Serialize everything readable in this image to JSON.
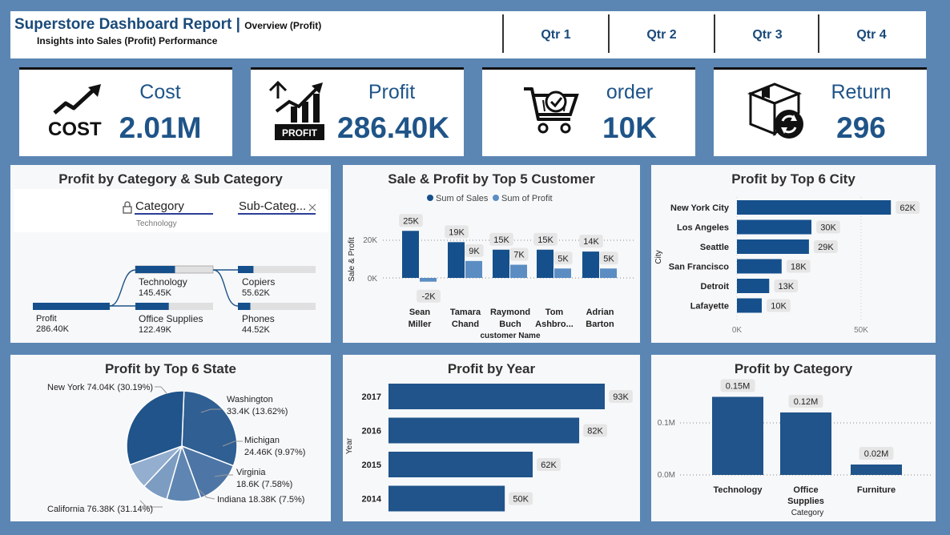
{
  "header": {
    "title": "Superstore Dashboard Report",
    "separator": "|",
    "page": "Overview (Profit)",
    "subtitle": "Insights into Sales (Profit) Performance",
    "quarters": [
      "Qtr 1",
      "Qtr 2",
      "Qtr 3",
      "Qtr 4"
    ]
  },
  "kpis": [
    {
      "label": "Cost",
      "value": "2.01M",
      "icon": "cost-trend-icon",
      "icon_text": "COST"
    },
    {
      "label": "Profit",
      "value": "286.40K",
      "icon": "profit-chart-icon",
      "icon_text": "PROFIT"
    },
    {
      "label": "order",
      "value": "10K",
      "icon": "shopping-cart-check-icon"
    },
    {
      "label": "Return",
      "value": "296",
      "icon": "return-box-icon"
    }
  ],
  "colors": {
    "primary": "#1f5488",
    "bar_dark": "#15508c",
    "bar_light": "#5b8dc3",
    "background": "#5b86b4"
  },
  "decomp_tree": {
    "title": "Profit by Category & Sub Category",
    "level1_label": "Category",
    "level1_value": "Technology",
    "level2_label": "Sub-Categ...",
    "root": {
      "label": "Profit",
      "value": "286.40K"
    },
    "categories": [
      {
        "label": "Technology",
        "value": "145.45K",
        "fraction": 0.51,
        "selected": true
      },
      {
        "label": "Office Supplies",
        "value": "122.49K",
        "fraction": 0.43
      }
    ],
    "subcategories": [
      {
        "label": "Copiers",
        "value": "55.62K",
        "fraction": 0.2
      },
      {
        "label": "Phones",
        "value": "44.52K",
        "fraction": 0.16
      }
    ]
  },
  "customers_chart": {
    "title": "Sale & Profit by Top 5 Customer",
    "ylabel": "Sale & Profit",
    "xlabel": "customer Name",
    "legend": [
      "Sum of Sales",
      "Sum of Profit"
    ],
    "yticks": [
      "20K",
      "0K"
    ],
    "categories": [
      [
        "Sean",
        "Miller"
      ],
      [
        "Tamara",
        "Chand"
      ],
      [
        "Raymond",
        "Buch"
      ],
      [
        "Tom",
        "Ashbro..."
      ],
      [
        "Adrian",
        "Barton"
      ]
    ],
    "sales_labels": [
      "25K",
      "19K",
      "15K",
      "15K",
      "14K"
    ],
    "profit_labels": [
      "-2K",
      "9K",
      "7K",
      "5K",
      "5K"
    ]
  },
  "city_chart": {
    "title": "Profit by Top 6 City",
    "ylabel": "City",
    "xticks": [
      "0K",
      "50K"
    ],
    "labels": [
      "62K",
      "30K",
      "29K",
      "18K",
      "13K",
      "10K"
    ]
  },
  "state_chart": {
    "title": "Profit by Top 6 State",
    "labels": [
      "New York 74.04K (30.19%)",
      [
        "Washington",
        "33.4K (13.62%)"
      ],
      [
        "Michigan",
        "24.46K (9.97%)"
      ],
      [
        "Virginia",
        "18.6K (7.58%)"
      ],
      "Indiana 18.38K (7.5%)",
      "California 76.38K (31.14%)"
    ]
  },
  "year_chart": {
    "title": "Profit by Year",
    "ylabel": "Year",
    "labels": [
      "93K",
      "82K",
      "62K",
      "50K"
    ]
  },
  "category_chart": {
    "title": "Profit by Category",
    "xlabel": "Category",
    "yticks": [
      "0.1M",
      "0.0M"
    ],
    "categories": [
      [
        "Technology"
      ],
      [
        "Office",
        "Supplies"
      ],
      [
        "Furniture"
      ]
    ],
    "labels": [
      "0.15M",
      "0.12M",
      "0.02M"
    ]
  },
  "chart_data": [
    {
      "type": "bar",
      "title": "Sale & Profit by Top 5 Customer",
      "xlabel": "customer Name",
      "ylabel": "Sale & Profit",
      "categories": [
        "Sean Miller",
        "Tamara Chand",
        "Raymond Buch",
        "Tom Ashbro...",
        "Adrian Barton"
      ],
      "series": [
        {
          "name": "Sum of Sales",
          "values": [
            25000,
            19000,
            15000,
            15000,
            14000
          ]
        },
        {
          "name": "Sum of Profit",
          "values": [
            -2000,
            9000,
            7000,
            5000,
            5000
          ]
        }
      ],
      "ylim": [
        -4000,
        30000
      ],
      "legend": "top"
    },
    {
      "type": "bar",
      "orientation": "horizontal",
      "title": "Profit by Top 6 City",
      "ylabel": "City",
      "categories": [
        "New York City",
        "Los Angeles",
        "Seattle",
        "San Francisco",
        "Detroit",
        "Lafayette"
      ],
      "values": [
        62000,
        30000,
        29000,
        18000,
        13000,
        10000
      ],
      "xlim": [
        0,
        65000
      ]
    },
    {
      "type": "pie",
      "title": "Profit by Top 6 State",
      "categories": [
        "New York",
        "Washington",
        "Michigan",
        "Virginia",
        "Indiana",
        "California"
      ],
      "values": [
        74040,
        33400,
        24460,
        18600,
        18380,
        76380
      ],
      "percents": [
        30.19,
        13.62,
        9.97,
        7.58,
        7.5,
        31.14
      ]
    },
    {
      "type": "bar",
      "orientation": "horizontal",
      "title": "Profit by Year",
      "ylabel": "Year",
      "categories": [
        "2017",
        "2016",
        "2015",
        "2014"
      ],
      "values": [
        93000,
        82000,
        62000,
        50000
      ],
      "xlim": [
        0,
        100000
      ]
    },
    {
      "type": "bar",
      "title": "Profit by Category",
      "xlabel": "Category",
      "categories": [
        "Technology",
        "Office Supplies",
        "Furniture"
      ],
      "values": [
        0.15,
        0.12,
        0.02
      ],
      "unit": "M",
      "ylim": [
        0,
        0.16
      ]
    }
  ]
}
